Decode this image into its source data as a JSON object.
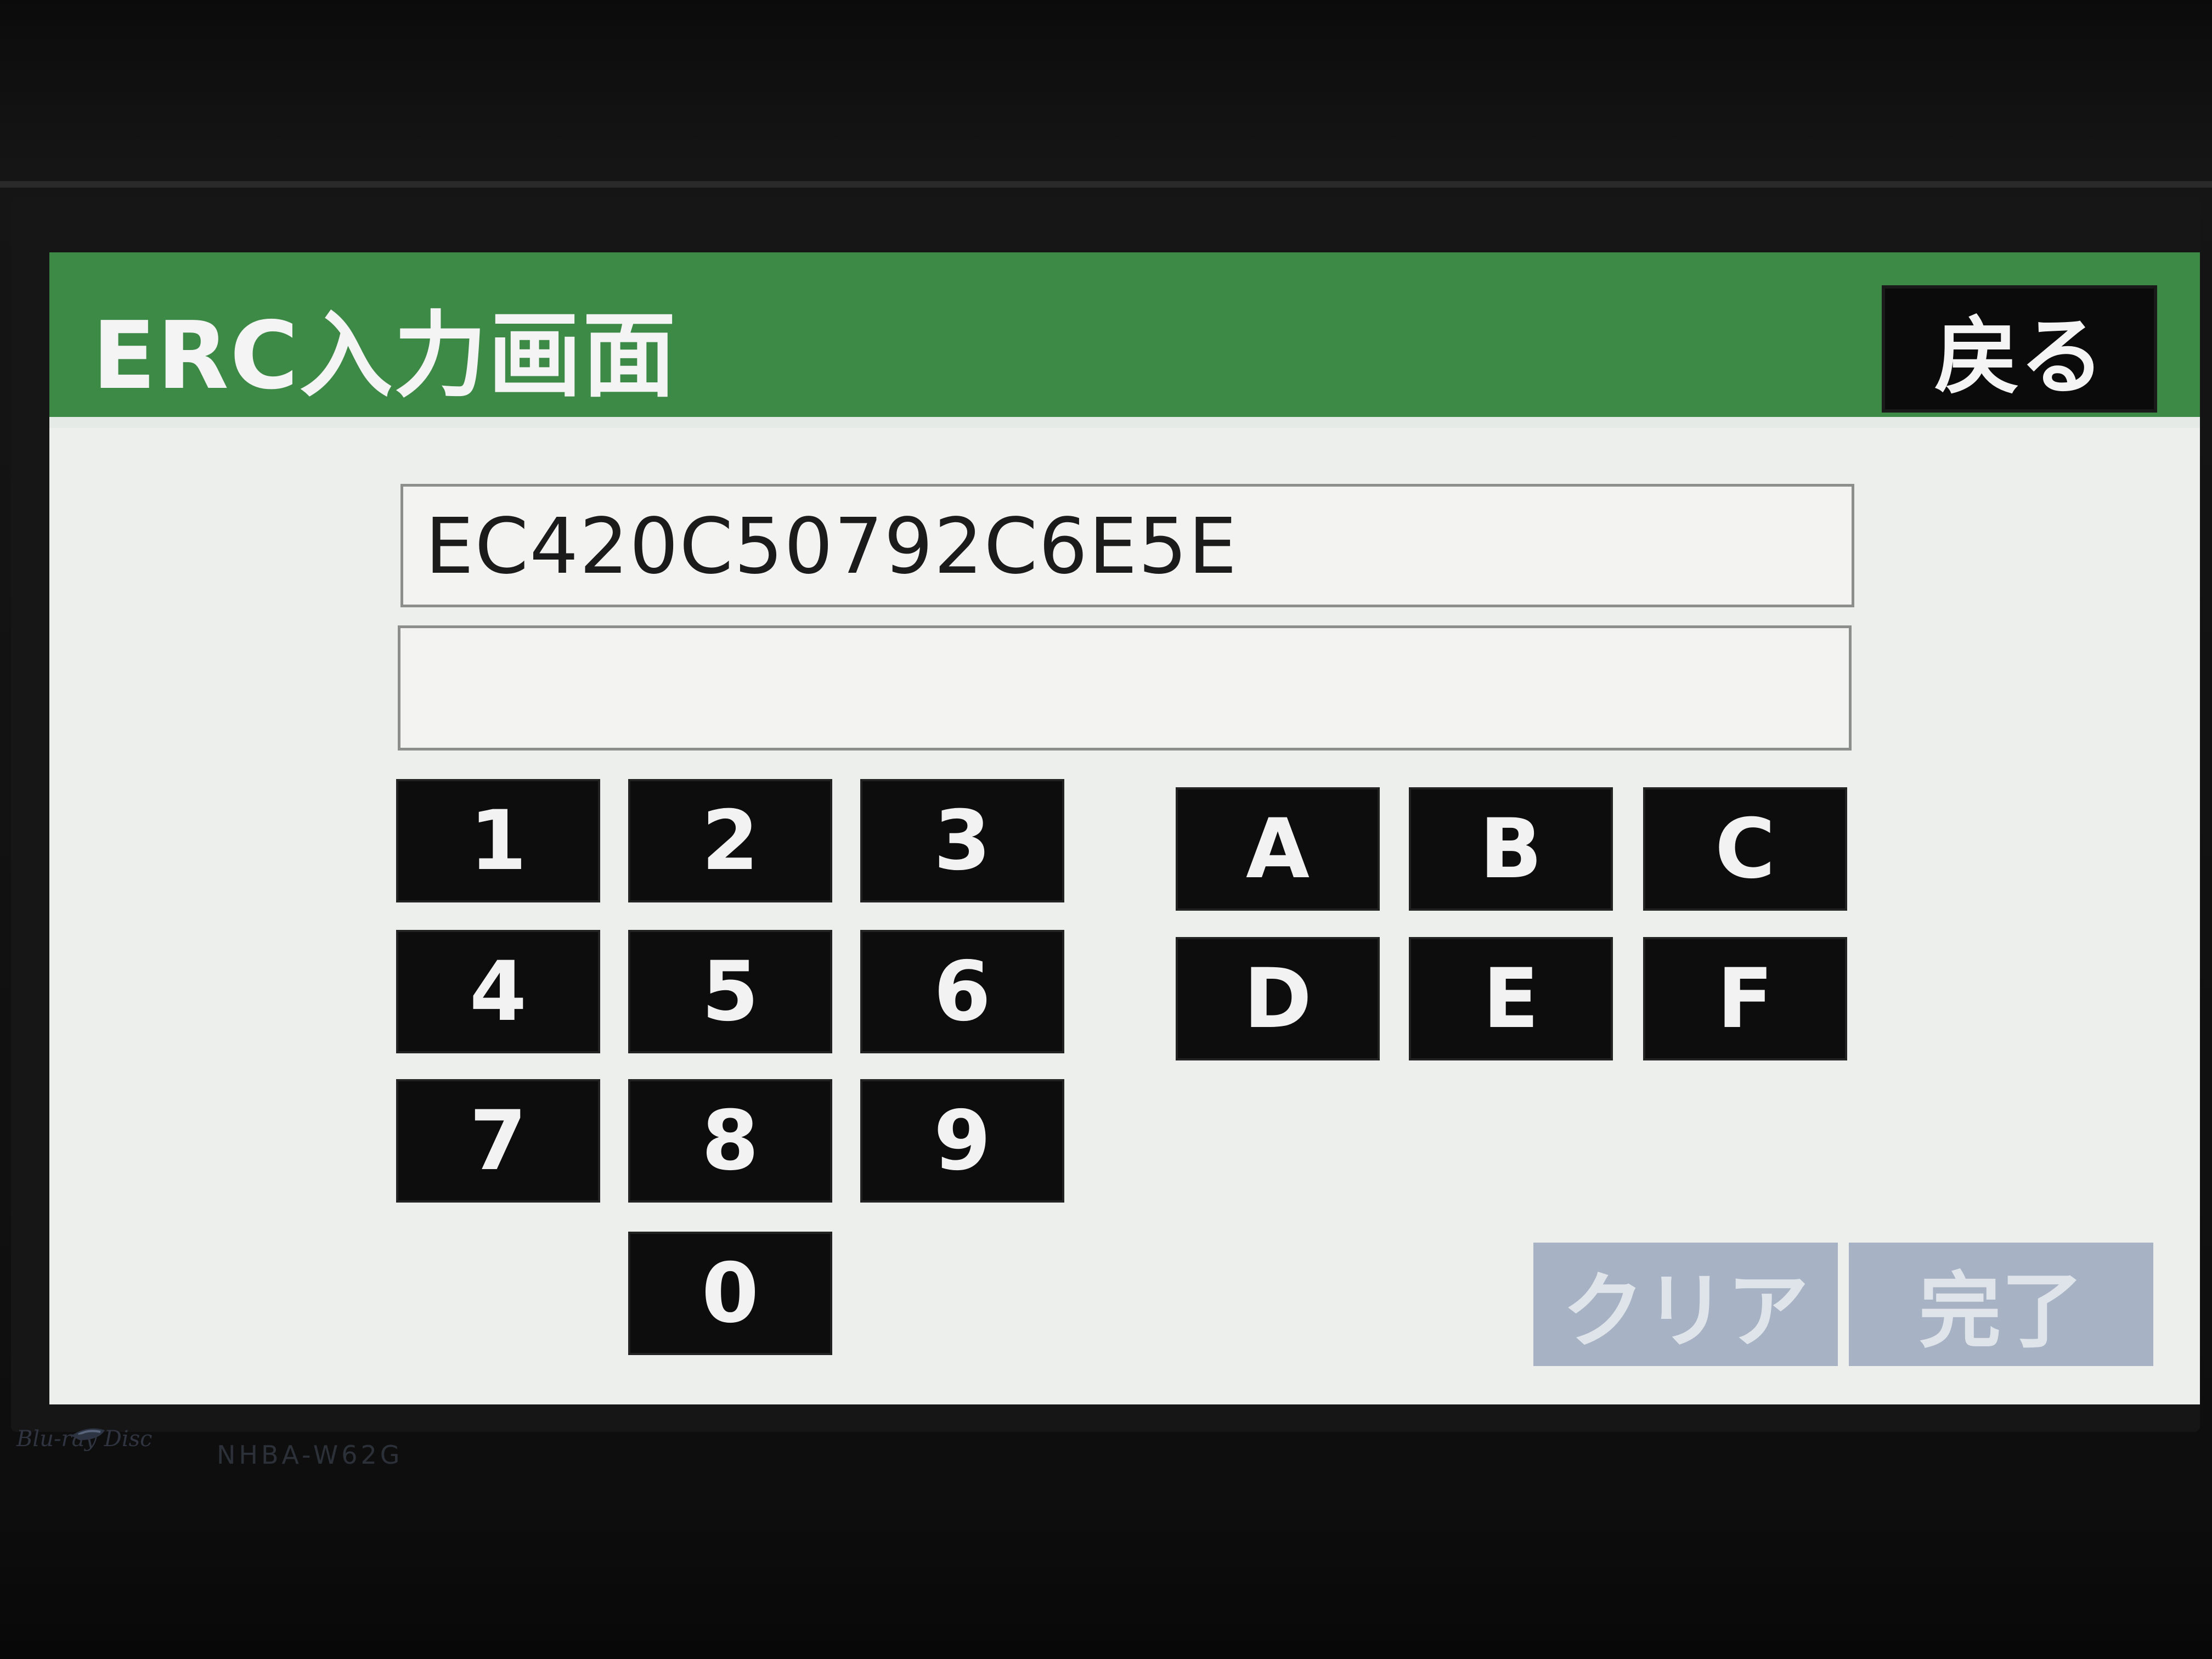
{
  "screen": {
    "title": "ERC入力画面",
    "back_label": "戻る"
  },
  "fields": {
    "code_value": "EC420C50792C6E5E",
    "input_value": ""
  },
  "keypad": {
    "numeric": [
      "1",
      "2",
      "3",
      "4",
      "5",
      "6",
      "7",
      "8",
      "9",
      "0"
    ],
    "hex": [
      "A",
      "B",
      "C",
      "D",
      "E",
      "F"
    ]
  },
  "actions": {
    "clear_label": "クリア",
    "done_label": "完了"
  },
  "device": {
    "brand_text": "Blu-ray Disc",
    "model": "NHBA-W62G"
  },
  "colors": {
    "header": "#3d8a47",
    "key": "#0d0d0d",
    "disabled_button": "#a7b3c4"
  }
}
